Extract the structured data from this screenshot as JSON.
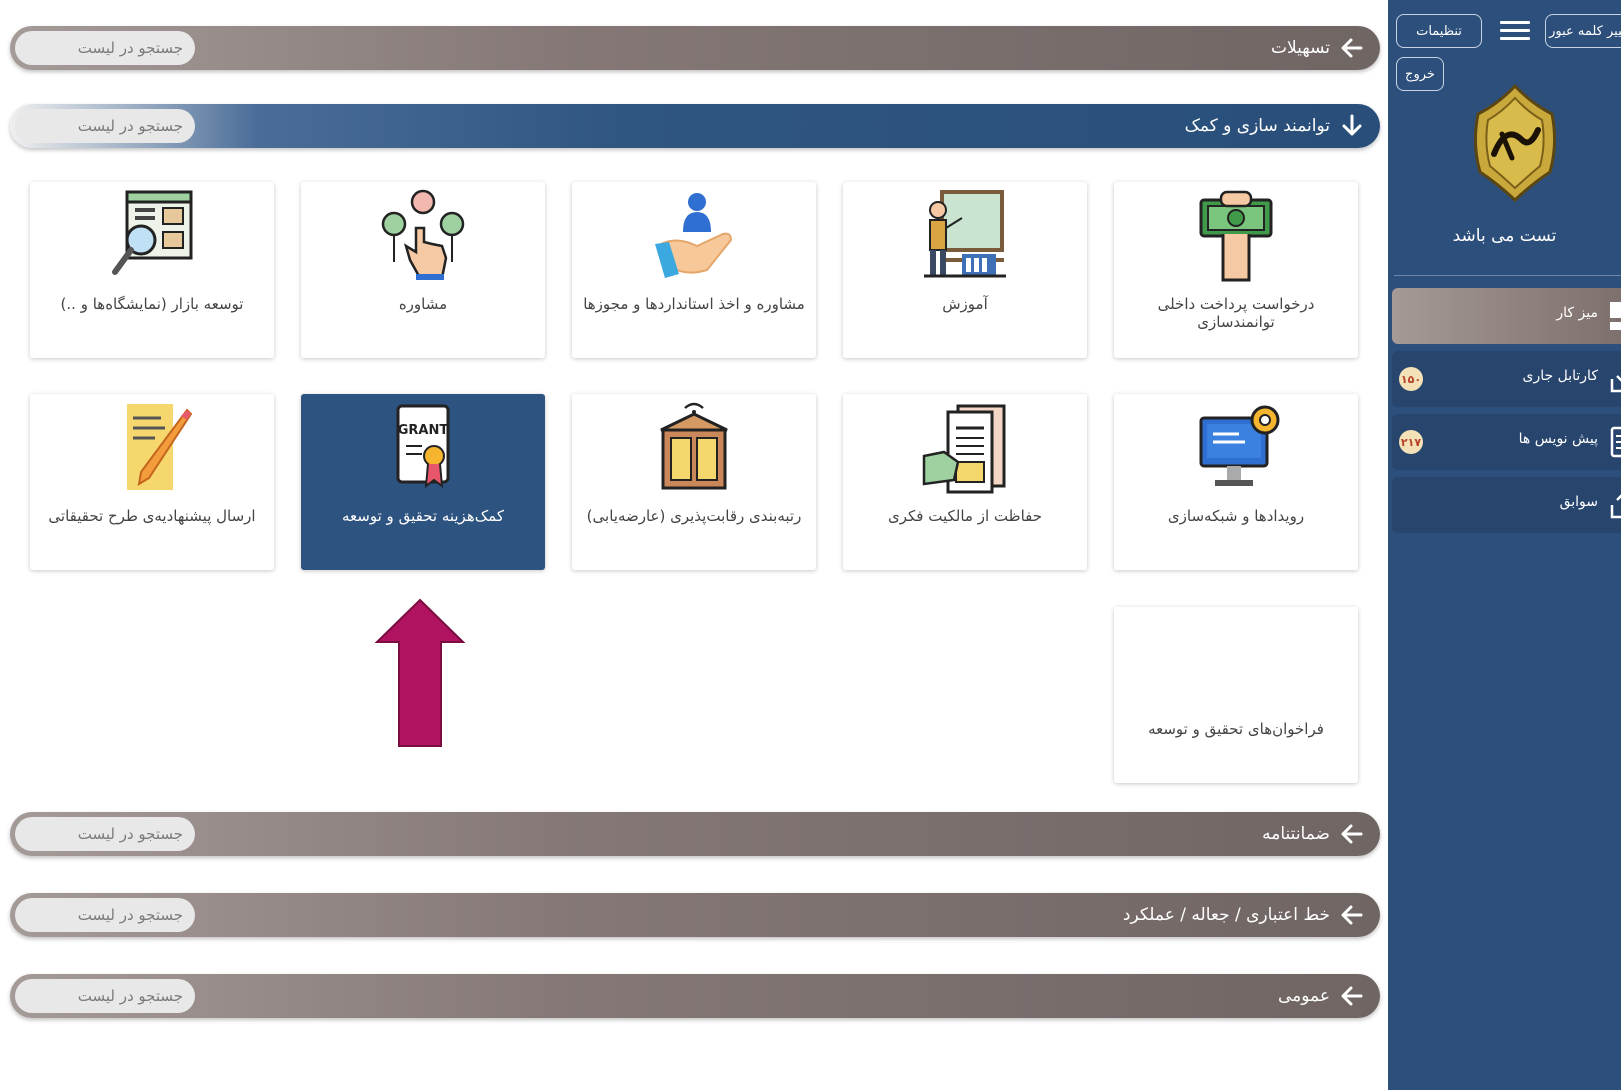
{
  "search_placeholder": "جستجو در لیست",
  "sections": {
    "facilities": "تسهیلات",
    "empowerment": "توانمند سازی و کمک",
    "guarantee": "ضمانتنامه",
    "credit_line": "خط اعتباری / جعاله / عملکرد",
    "general": "عمومی"
  },
  "cards": [
    {
      "label": "درخواست پرداخت داخلی توانمندسازی",
      "icon": "hand-money-icon"
    },
    {
      "label": "آموزش",
      "icon": "teacher-board-icon"
    },
    {
      "label": "مشاوره و اخذ استانداردها و مجوزها",
      "icon": "hand-person-icon"
    },
    {
      "label": "مشاوره",
      "icon": "touch-network-icon"
    },
    {
      "label": "توسعه بازار (نمایشگاه‌ها و ..)",
      "icon": "market-magnifier-icon"
    },
    {
      "label": "رویدادها و شبکه‌سازی",
      "icon": "computer-gear-icon"
    },
    {
      "label": "حفاظت از مالکیت فکری",
      "icon": "document-hand-icon"
    },
    {
      "label": "رتبه‌بندی رقابت‌پذیری (عارضه‌یابی)",
      "icon": "building-wifi-icon"
    },
    {
      "label": "کمک‌هزینه تحقیق و توسعه",
      "icon": "grant-certificate-icon",
      "grant_text": "GRANT"
    },
    {
      "label": "ارسال پیشنهادیه‌ی طرح تحقیقاتی",
      "icon": "notepad-pencil-icon"
    },
    {
      "label": "فراخوان‌های تحقیق و توسعه",
      "icon": ""
    }
  ],
  "sidebar": {
    "change_password": "تغییر کلمه عبور",
    "settings": "تنظیمات",
    "logout": "خروج",
    "username": "تست می باشد",
    "nav": [
      {
        "label": "میز کار",
        "icon": "dashboard-icon"
      },
      {
        "label": "کارتابل جاری",
        "icon": "inbox-icon",
        "badge": "۱۵۰"
      },
      {
        "label": "پیش نویس ها",
        "icon": "draft-icon",
        "badge": "۲۱۷"
      },
      {
        "label": "سوابق",
        "icon": "outbox-icon"
      }
    ]
  },
  "colors": {
    "accent_blue": "#2d5380",
    "collapsed_bar": "#6f6563",
    "pointer_arrow": "#b0135f",
    "badge_bg": "#f5e1b8"
  }
}
